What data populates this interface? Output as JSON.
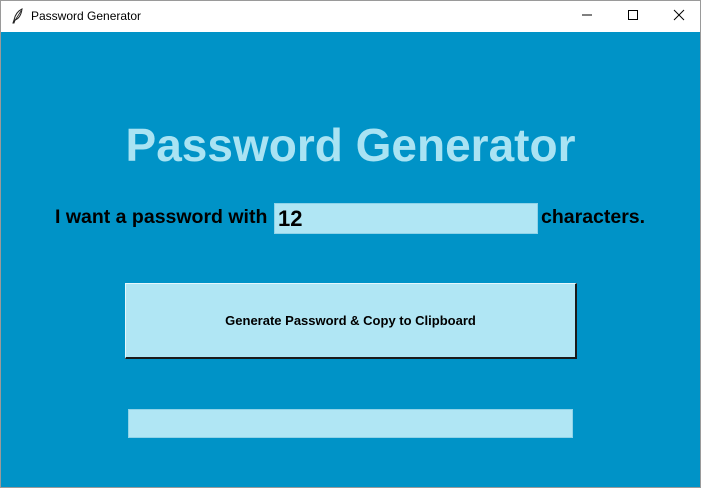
{
  "window": {
    "title": "Password Generator",
    "icon": "feather-icon",
    "controls": [
      "minimize-icon",
      "maximize-icon",
      "close-icon"
    ]
  },
  "main": {
    "heading": "Password Generator",
    "label_before": "I want a password with",
    "length_value": "12",
    "label_after": "characters.",
    "generate_button_label": "Generate Password & Copy to Clipboard",
    "output_value": ""
  },
  "colors": {
    "background": "#0093c7",
    "heading": "#a9e3f3",
    "field": "#b0e6f4"
  }
}
